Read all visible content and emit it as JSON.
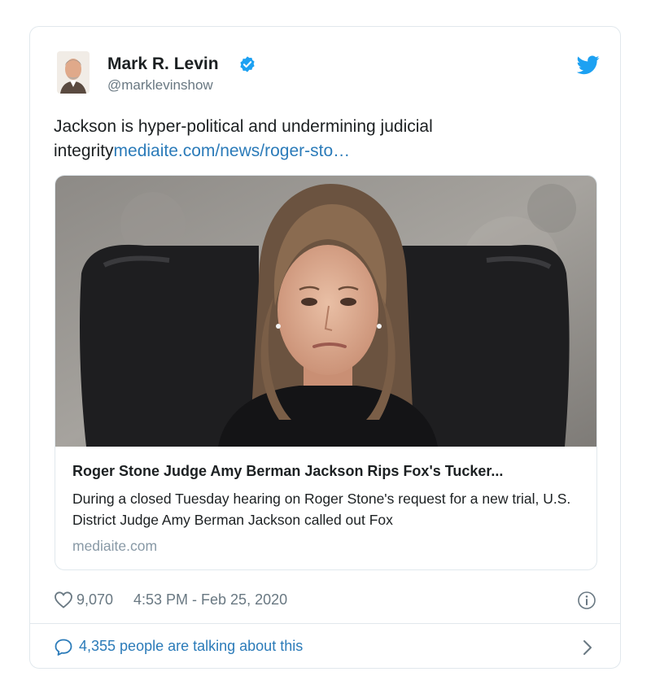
{
  "tweet": {
    "author_name": "Mark R. Levin",
    "handle": "@marklevinshow",
    "text": "Jackson is hyper-political and undermining judicial integrity",
    "link_text": "mediaite.com/news/roger-sto…"
  },
  "link_card": {
    "title": "Roger Stone Judge Amy Berman Jackson Rips Fox's Tucker...",
    "description": "During a closed Tuesday hearing on Roger Stone's request for a new trial, U.S. District Judge Amy Berman Jackson called out Fox",
    "domain": "mediaite.com"
  },
  "meta": {
    "likes": "9,070",
    "timestamp": "4:53 PM - Feb 25, 2020"
  },
  "footer": {
    "talking_text": "4,355 people are talking about this"
  },
  "icons": {
    "verified": "verified-badge-icon",
    "brand": "twitter-bird-icon",
    "like": "heart-icon",
    "info": "info-icon",
    "reply": "speech-bubble-icon",
    "more": "chevron-right-icon"
  },
  "colors": {
    "accent": "#1da1f2",
    "link": "#2b7bb9",
    "muted": "#697882",
    "border": "#e1e8ed"
  }
}
